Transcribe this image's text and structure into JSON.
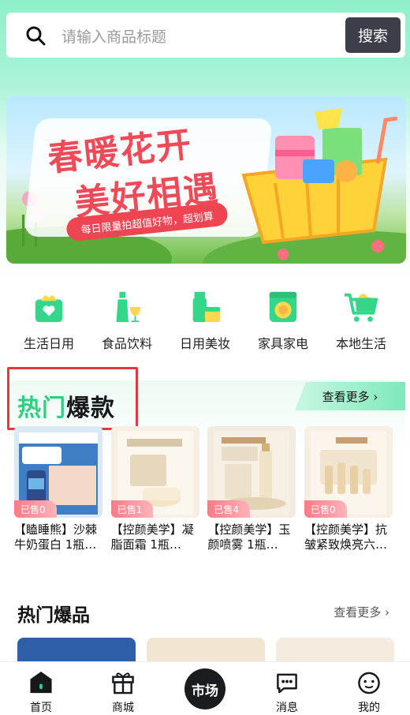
{
  "search": {
    "placeholder": "请输入商品标题",
    "button_label": "搜索"
  },
  "banner": {
    "title_line1": "春暖花开",
    "title_line2": "美好相遇",
    "slogan": "每日限量拍超值好物，超划算"
  },
  "categories": [
    {
      "label": "生活日用",
      "icon": "daily-goods-icon"
    },
    {
      "label": "食品饮料",
      "icon": "food-drink-icon"
    },
    {
      "label": "日用美妆",
      "icon": "cosmetics-icon"
    },
    {
      "label": "家具家电",
      "icon": "appliance-icon"
    },
    {
      "label": "本地生活",
      "icon": "local-life-icon"
    }
  ],
  "hot_section": {
    "title_green": "热门",
    "title_dark": "爆款",
    "more_label": "查看更多 ›",
    "products": [
      {
        "name": "【瞌睡熊】沙棘牛奶蛋白 1瓶…",
        "sold": "已售0"
      },
      {
        "name": "【控颜美学】凝脂面霜 1瓶…",
        "sold": "已售1"
      },
      {
        "name": "【控颜美学】玉颜喷雾 1瓶…",
        "sold": "已售4"
      },
      {
        "name": "【控颜美学】抗皱紧致焕亮六…",
        "sold": "已售0"
      }
    ]
  },
  "hot_section2": {
    "title": "热门爆品",
    "more_label": "查看更多 ›"
  },
  "bottom_nav": {
    "home": "首页",
    "mall": "商城",
    "market": "市场",
    "messages": "消息",
    "mine": "我的"
  },
  "colors": {
    "accent_green": "#2ecf7e",
    "highlight_red": "#e8373c",
    "search_button": "#3c3f4a"
  }
}
